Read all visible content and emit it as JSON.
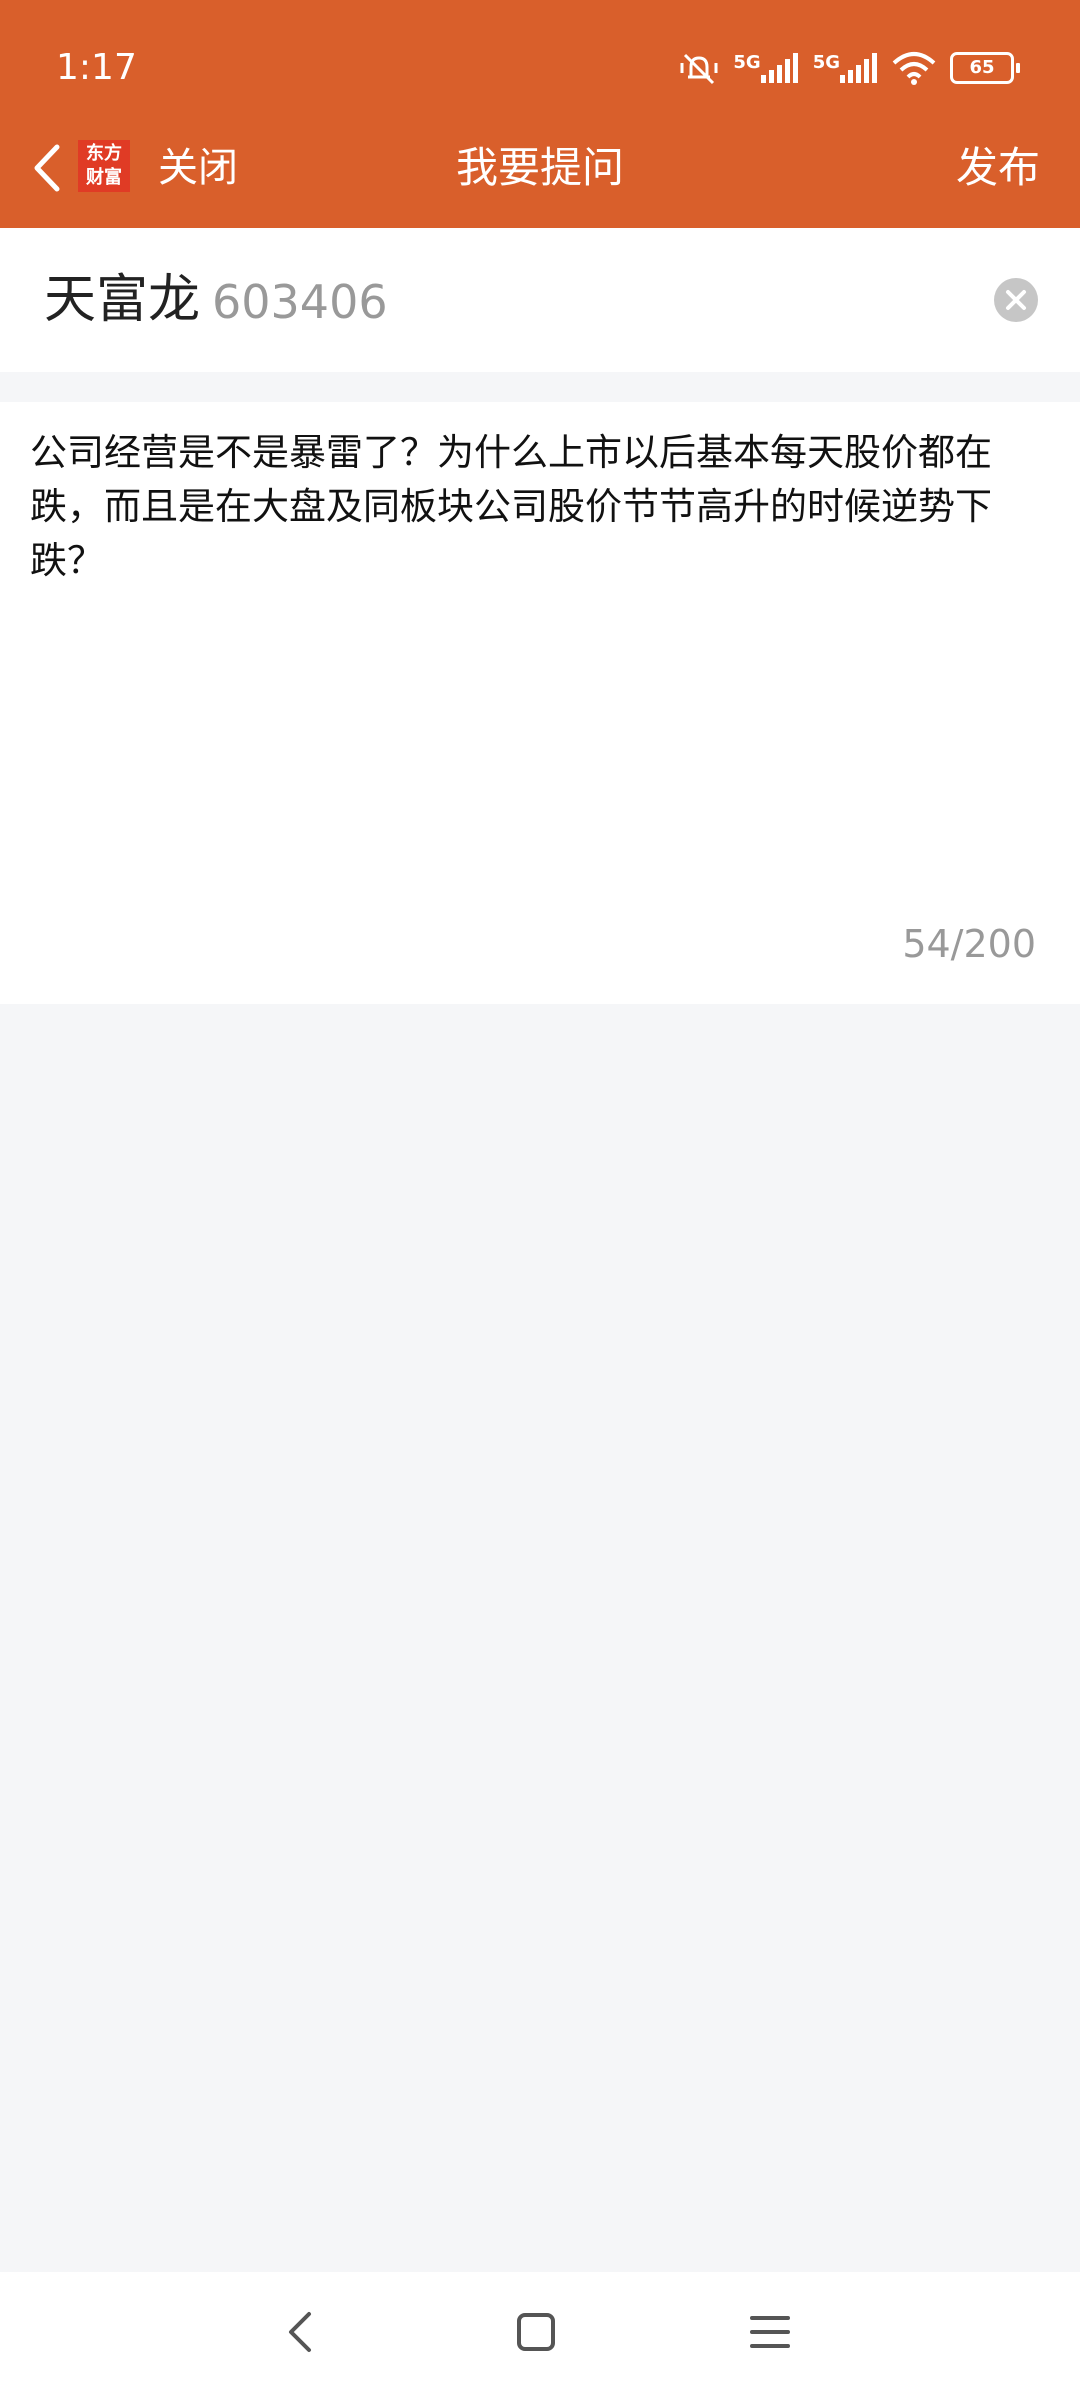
{
  "status_bar": {
    "time": "1:17",
    "network_1": "5G",
    "network_2": "5G",
    "battery": "65"
  },
  "toolbar": {
    "logo_line1": "东方",
    "logo_line2": "财富",
    "close_label": "关闭",
    "title": "我要提问",
    "publish_label": "发布"
  },
  "stock": {
    "name": "天富龙",
    "code": "603406"
  },
  "question": {
    "text": "公司经营是不是暴雷了？为什么上市以后基本每天股价都在跌，而且是在大盘及同板块公司股价节节高升的时候逆势下跌？",
    "counter": "54/200"
  },
  "colors": {
    "header": "#d95f2b",
    "page_background": "#f5f6f8",
    "logo": "#e03b25"
  }
}
